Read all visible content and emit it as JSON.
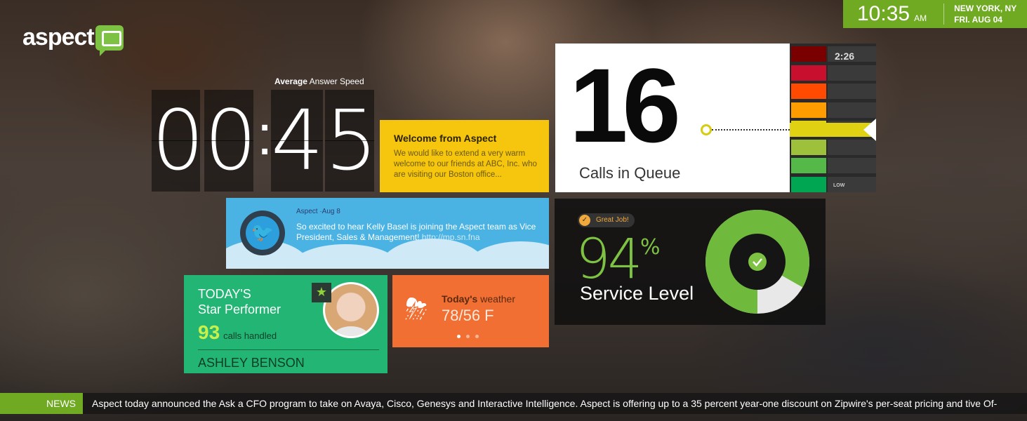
{
  "brand": {
    "logo_text": "aspect"
  },
  "clock": {
    "time": "10:35",
    "ampm": "AM",
    "location": "NEW YORK, NY",
    "date": "FRI. AUG 04"
  },
  "answer_speed": {
    "label_bold": "Average",
    "label_rest": " Answer Speed",
    "digits": [
      "0",
      "0",
      "4",
      "5"
    ],
    "separator": ":"
  },
  "welcome": {
    "title": "Welcome from Aspect",
    "body": "We would like to extend a very warm welcome to our friends at ABC, Inc. who are visiting our Boston office..."
  },
  "tweet": {
    "meta": "Aspect ·Aug 8",
    "text": "So excited to hear Kelly Basel is joining the Aspect team as Vice President, Sales & Management!",
    "link": "http://mp.sn.fna",
    "icon": "twitter-bird-icon"
  },
  "star_performer": {
    "title_line1": "TODAY'S",
    "title_line2": "Star Performer",
    "calls_count": "93",
    "calls_label": "calls handled",
    "name": "ASHLEY BENSON",
    "badge_icon": "star-icon"
  },
  "weather": {
    "title_bold": "Today's",
    "title_rest": " weather",
    "temperature": "78/56 F",
    "icon": "sun-cloud-storm-icon",
    "pages": 3,
    "active_page": 1
  },
  "queue": {
    "count": "16",
    "label": "Calls in Queue",
    "scale_time": "2:26",
    "scale_low": "LOW",
    "scale_colors": [
      "#7a0000",
      "#c8102e",
      "#ff4a00",
      "#ff9c00",
      "#e0d212",
      "#9ec13c",
      "#55b94a",
      "#00a651"
    ]
  },
  "service_level": {
    "badge": "Great Job!",
    "percent": "94",
    "percent_sign": "%",
    "label": "Service Level",
    "value": 0.94,
    "colors": {
      "ring": "#6fba3c",
      "remainder": "#e8e8e8",
      "check": "#7dc242"
    }
  },
  "news": {
    "tag": "NEWS",
    "text": "Aspect today announced the Ask a CFO program to take on Avaya, Cisco, Genesys and Interactive Intelligence. Aspect is offering up to a 35 percent year-one discount on Zipwire's per-seat pricing and tive Of-"
  }
}
